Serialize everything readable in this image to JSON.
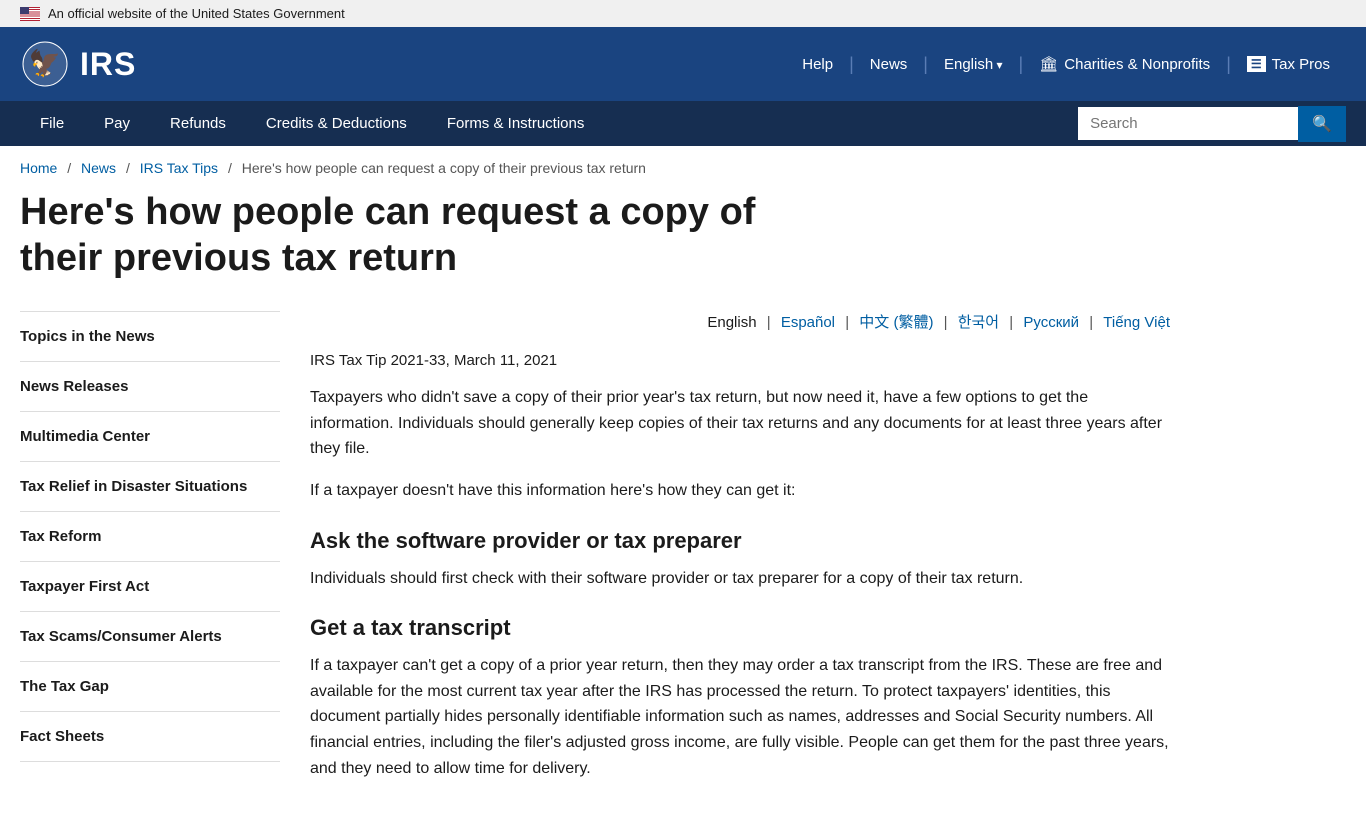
{
  "gov_banner": {
    "text": "An official website of the United States Government"
  },
  "header": {
    "logo_text": "IRS",
    "nav_items": [
      {
        "label": "Help",
        "has_arrow": false
      },
      {
        "label": "News",
        "has_arrow": false
      },
      {
        "label": "English",
        "has_arrow": true
      },
      {
        "label": "Charities & Nonprofits",
        "icon": "charities"
      },
      {
        "label": "Tax Pros",
        "icon": "taxpros"
      }
    ]
  },
  "nav_bar": {
    "links": [
      {
        "label": "File"
      },
      {
        "label": "Pay"
      },
      {
        "label": "Refunds"
      },
      {
        "label": "Credits & Deductions"
      },
      {
        "label": "Forms & Instructions"
      }
    ],
    "search_placeholder": "Search"
  },
  "breadcrumb": {
    "items": [
      {
        "label": "Home",
        "href": "#"
      },
      {
        "label": "News",
        "href": "#"
      },
      {
        "label": "IRS Tax Tips",
        "href": "#"
      }
    ],
    "current": "Here's how people can request a copy of their previous tax return"
  },
  "page_title": "Here's how people can request a copy of their previous tax return",
  "lang_switcher": {
    "current": "English",
    "links": [
      {
        "label": "Español"
      },
      {
        "label": "中文 (繁體)"
      },
      {
        "label": "한국어"
      },
      {
        "label": "Русский"
      },
      {
        "label": "Tiếng Việt"
      }
    ]
  },
  "article": {
    "meta": "IRS Tax Tip 2021-33, March 11, 2021",
    "intro": "Taxpayers who didn't save a copy of their prior year's tax return, but now need it, have a few options to get the information. Individuals should generally keep copies of their tax returns and any documents for at least three years after they file.",
    "intro2": "If a taxpayer doesn't have this information here's how they can get it:",
    "sections": [
      {
        "heading": "Ask the software provider or tax preparer",
        "body": "Individuals should first check with their software provider or tax preparer for a copy of their tax return."
      },
      {
        "heading": "Get a tax transcript",
        "body": "If a taxpayer can't get a copy of a prior year return, then they may order a tax transcript from the IRS. These are free and available for the most current tax year after the IRS has processed the return. To protect taxpayers' identities, this document partially hides personally identifiable information such as names, addresses and Social Security numbers. All financial entries, including the filer's adjusted gross income, are fully visible. People can get them for the past three years, and they need to allow time for delivery."
      }
    ]
  },
  "sidebar": {
    "title": "Topics in the News",
    "items": [
      {
        "label": "Topics in the News"
      },
      {
        "label": "News Releases"
      },
      {
        "label": "Multimedia Center"
      },
      {
        "label": "Tax Relief in Disaster Situations"
      },
      {
        "label": "Tax Reform"
      },
      {
        "label": "Taxpayer First Act"
      },
      {
        "label": "Tax Scams/Consumer Alerts"
      },
      {
        "label": "The Tax Gap"
      },
      {
        "label": "Fact Sheets"
      }
    ]
  }
}
